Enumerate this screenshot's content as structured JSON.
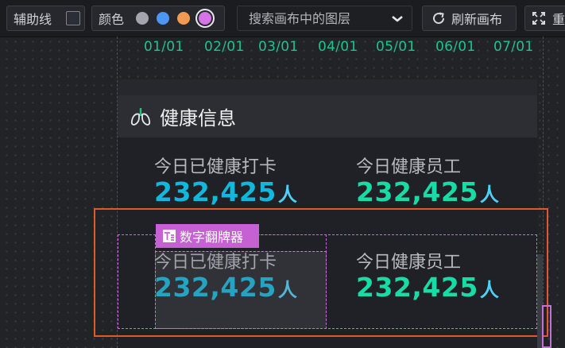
{
  "toolbar": {
    "guide_label": "辅助线",
    "color_label": "颜色",
    "swatches": [
      "#a3a6ad",
      "#4c97f5",
      "#f39a52",
      "#d474e6"
    ],
    "search_placeholder": "搜索画布中的图层",
    "refresh_label": "刷新画布",
    "fullscreen_label": "重"
  },
  "timeline": {
    "ticks": [
      "01/01",
      "02/01",
      "03/01",
      "04/01",
      "05/01",
      "06/01",
      "07/01"
    ]
  },
  "widget": {
    "title": "健康信息",
    "rows": [
      {
        "left": {
          "label": "今日已健康打卡",
          "value": "232,425",
          "unit": "人"
        },
        "right": {
          "label": "今日健康员工",
          "value": "232,425",
          "unit": "人"
        }
      },
      {
        "left": {
          "label": "今日已健康打卡",
          "value": "232,425",
          "unit": "人"
        },
        "right": {
          "label": "今日健康员工",
          "value": "232,425",
          "unit": "人"
        }
      }
    ]
  },
  "selection": {
    "component_tag": "数字翻牌器"
  },
  "colors": {
    "accent_cyan": "#12b8dc",
    "accent_green": "#18dba5",
    "selection_orange": "#e2572e",
    "selection_magenta": "#c561d2"
  }
}
